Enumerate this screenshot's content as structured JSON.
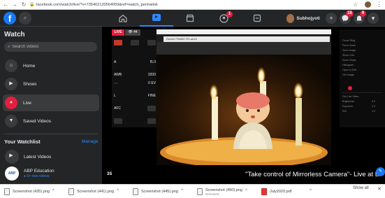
{
  "browser": {
    "url": "facebook.com/watch/live/?v=735462120564059&ref=watch_permalink",
    "nav_back": "←",
    "nav_forward": "→",
    "nav_reload": "↻",
    "lock_glyph": "🔒",
    "star_glyph": "☆",
    "menu_glyph": "⋮"
  },
  "fb_header": {
    "logo": "f",
    "search_glyph": "⌕",
    "profile_name": "Subhojyoti",
    "create_glyph": "+",
    "menu_glyph": "▾",
    "badges": {
      "groups": "1",
      "messenger": "18",
      "notifications": "9"
    }
  },
  "sidebar": {
    "title": "Watch",
    "search_placeholder": "Search videos",
    "items": [
      {
        "label": "Home",
        "icon": "home-icon",
        "glyph": "⌂"
      },
      {
        "label": "Shows",
        "icon": "shows-icon",
        "glyph": "▶"
      },
      {
        "label": "Live",
        "icon": "live-icon",
        "glyph": "●",
        "active": true
      },
      {
        "label": "Saved Videos",
        "icon": "saved-icon",
        "glyph": "▼"
      }
    ],
    "watchlist_title": "Your Watchlist",
    "manage_label": "Manage",
    "watchlist": [
      {
        "title": "Latest Videos",
        "meta": ""
      },
      {
        "title": "ABP Education",
        "meta": "● 9+ new videos"
      }
    ]
  },
  "video": {
    "live_tag": "LIVE",
    "viewers": "👁 44",
    "window_title": "Device F54867-RX-ab10",
    "inner_title": "Device F54867-RX-ab10",
    "caption": "\"Take control of Mirrorless Camera\"- Live at Bi",
    "left_fragment": "3S",
    "cam_values": {
      "aperture": "f5.0",
      "iso": "3200",
      "wb": "AWB",
      "ev": "0 EV",
      "mode": "A",
      "quality": "FINE",
      "af": "AFC",
      "size": "L"
    },
    "right_panel_lines": [
      "Focus Ring",
      "Pinch Zoom",
      "Save Image",
      "Show Grid",
      "Zoom Stops",
      "Histogram",
      "Open in Edit",
      "Get Image",
      "Get Live Video",
      "Brightness",
      "Exposure",
      "ISO"
    ],
    "right_panel_numbers": [
      "5.0",
      "2.0",
      "2.0"
    ]
  },
  "downloads": [
    {
      "name": "Screenshot (435).png",
      "sub": "",
      "type": "png"
    },
    {
      "name": "Screenshot (441).png",
      "sub": "",
      "type": "png"
    },
    {
      "name": "Screenshot (445).png",
      "sub": "",
      "type": "png"
    },
    {
      "name": "Screenshot (450).png",
      "sub": "Removed",
      "type": "png"
    },
    {
      "name": "July2020.pdf",
      "sub": "",
      "type": "pdf"
    }
  ],
  "show_all_label": "Show all",
  "shelf_close": "✕",
  "colors": {
    "fb_blue": "#1877f2",
    "live_red": "#e41e3f",
    "bg_dark": "#18191a",
    "panel": "#242526"
  }
}
